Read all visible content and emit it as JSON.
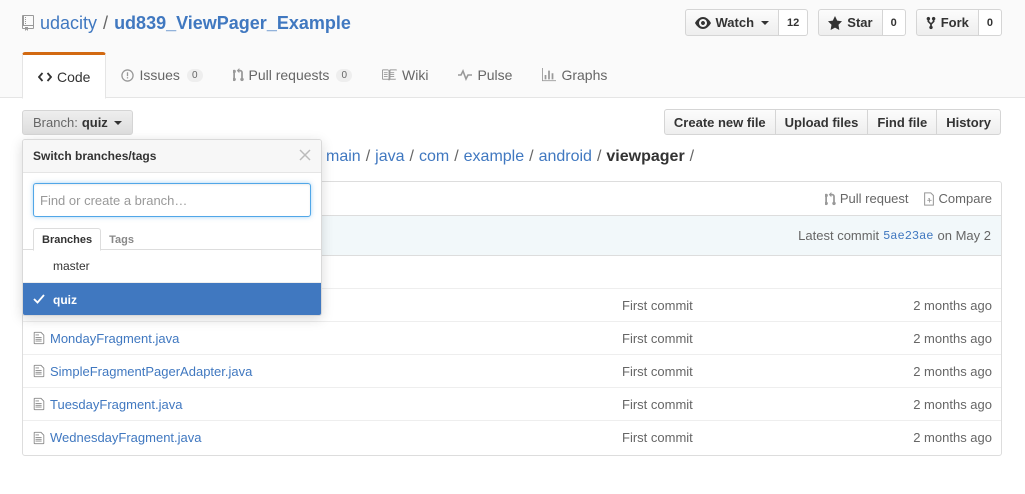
{
  "repo": {
    "owner": "udacity",
    "separator": "/",
    "name": "ud839_ViewPager_Example"
  },
  "actions": [
    {
      "label": "Watch",
      "count": "12"
    },
    {
      "label": "Star",
      "count": "0"
    },
    {
      "label": "Fork",
      "count": "0"
    }
  ],
  "tabs": [
    {
      "label": "Code"
    },
    {
      "label": "Issues",
      "counter": "0"
    },
    {
      "label": "Pull requests",
      "counter": "0"
    },
    {
      "label": "Wiki"
    },
    {
      "label": "Pulse"
    },
    {
      "label": "Graphs"
    }
  ],
  "branch": {
    "prefix": "Branch:",
    "name": "quiz"
  },
  "file_actions": [
    "Create new file",
    "Upload files",
    "Find file",
    "History"
  ],
  "breadcrumb": [
    "main",
    "java",
    "com",
    "example",
    "android"
  ],
  "breadcrumb_final": "viewpager",
  "breadcrumb_sep": "/",
  "header_links": {
    "pull_request": "Pull request",
    "compare": "Compare"
  },
  "commit": {
    "prefix": "Latest commit",
    "sha": "5ae23ae",
    "date": "on May 2"
  },
  "files": [
    {
      "name": "",
      "message": "First commit",
      "age": "2 months ago"
    },
    {
      "name": "MondayFragment.java",
      "message": "First commit",
      "age": "2 months ago"
    },
    {
      "name": "SimpleFragmentPagerAdapter.java",
      "message": "First commit",
      "age": "2 months ago"
    },
    {
      "name": "TuesdayFragment.java",
      "message": "First commit",
      "age": "2 months ago"
    },
    {
      "name": "WednesdayFragment.java",
      "message": "First commit",
      "age": "2 months ago"
    }
  ],
  "dropdown": {
    "title": "Switch branches/tags",
    "placeholder": "Find or create a branch…",
    "tabs": [
      "Branches",
      "Tags"
    ],
    "items": [
      "master",
      "quiz"
    ]
  },
  "colors": {
    "link": "#4078c0",
    "accent": "#d26911",
    "selected": "#4078c0"
  }
}
